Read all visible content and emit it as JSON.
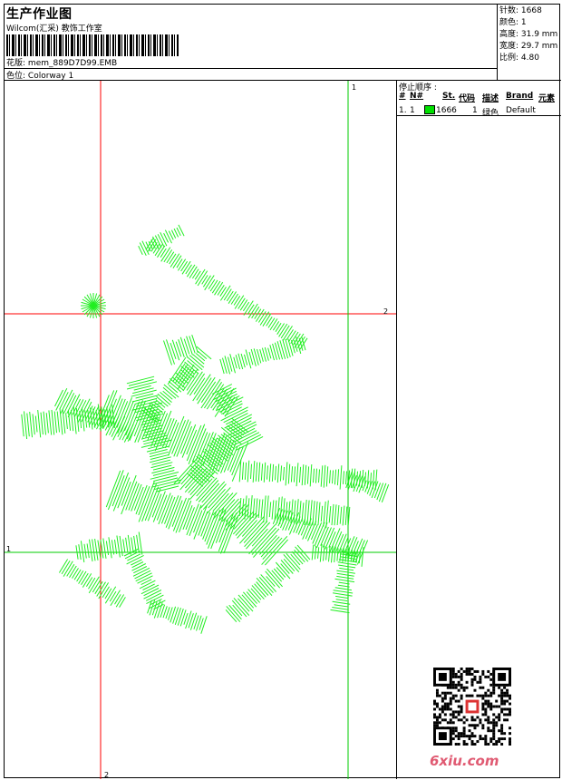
{
  "header": {
    "title": "生产作业图",
    "subtitle": "Wilcom(汇采) 教饰工作室",
    "design_label": "花版:",
    "design_value": "mem_889D7D99.EMB",
    "color_label": "色位:",
    "color_value": "Colorway 1"
  },
  "specs": {
    "stitches": "针数: 1668",
    "colors": "颜色: 1",
    "height": "高度: 31.9 mm",
    "width": "宽度: 29.7 mm",
    "ratio": "比例: 4.80"
  },
  "stop_sequence": {
    "caption": "停止顺序 :",
    "headers": [
      "#",
      "N#",
      "St.",
      "代码",
      "描述",
      "Brand",
      "元素"
    ],
    "row": {
      "num": "1.",
      "n": "1",
      "stitches": "1666",
      "code": "1",
      "desc": "绿色",
      "brand": "Default"
    },
    "color": "#00e000"
  },
  "guides": {
    "top_right": "1",
    "mid_right": "2",
    "left_mid": "1",
    "bottom": "2"
  },
  "watermark": "6xiu.com"
}
